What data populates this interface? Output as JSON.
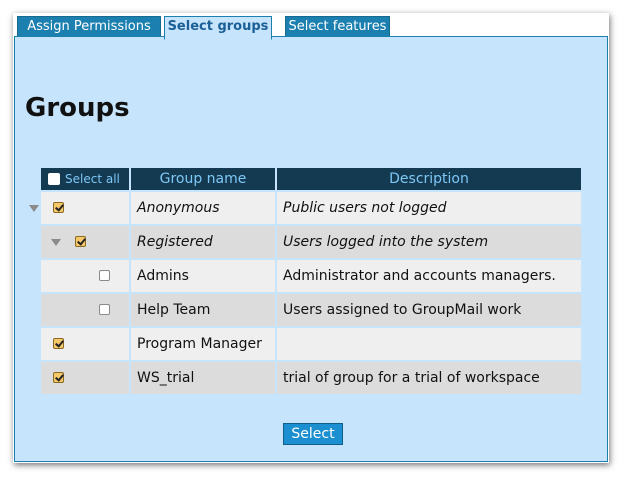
{
  "tabs": [
    {
      "label": "Assign Permissions",
      "active": false
    },
    {
      "label": "Select groups",
      "active": true
    },
    {
      "label": "Select features",
      "active": false
    }
  ],
  "heading": "Groups",
  "table": {
    "select_all_label": "Select all",
    "columns": [
      "Group name",
      "Description"
    ],
    "rows": [
      {
        "name": "Anonymous",
        "description": "Public users not logged",
        "checked": true,
        "level": 0,
        "expandable": true,
        "italic": true
      },
      {
        "name": "Registered",
        "description": "Users logged into the system",
        "checked": true,
        "level": 1,
        "expandable": true,
        "italic": true
      },
      {
        "name": "Admins",
        "description": "Administrator and accounts managers.",
        "checked": false,
        "level": 2,
        "expandable": false,
        "italic": false
      },
      {
        "name": "Help Team",
        "description": "Users assigned to GroupMail work",
        "checked": false,
        "level": 2,
        "expandable": false,
        "italic": false
      },
      {
        "name": "Program Manager",
        "description": "",
        "checked": true,
        "level": 0,
        "expandable": false,
        "italic": false
      },
      {
        "name": "WS_trial",
        "description": "trial of group for a trial of workspace",
        "checked": true,
        "level": 0,
        "expandable": false,
        "italic": false
      }
    ]
  },
  "select_button_label": "Select",
  "colors": {
    "tab_bg": "#1b7fb0",
    "panel_bg": "#c6e4fb",
    "header_bg": "#143a52",
    "header_text": "#7ec7f5",
    "button_bg": "#1b8fd0"
  }
}
